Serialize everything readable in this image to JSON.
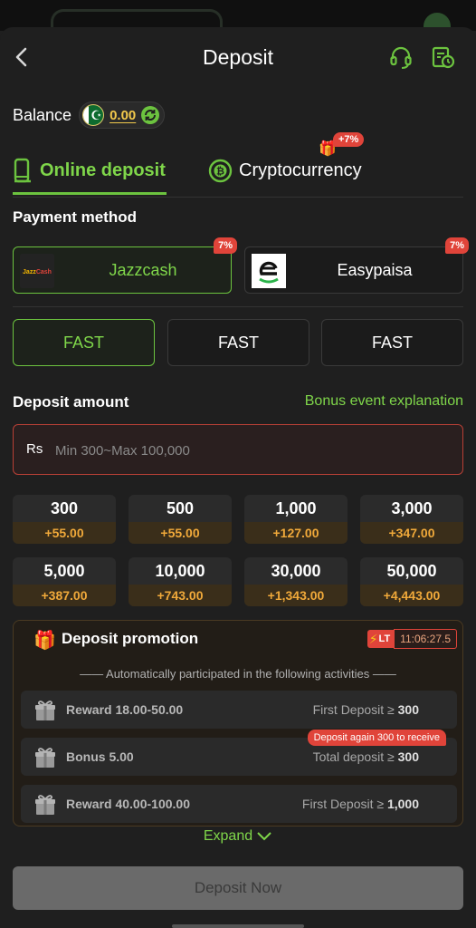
{
  "header": {
    "title": "Deposit"
  },
  "balance": {
    "label": "Balance",
    "currency_symbol": "☪",
    "value": "0.00"
  },
  "tabs": [
    {
      "label": "Online deposit",
      "active": true
    },
    {
      "label": "Cryptocurrency",
      "active": false,
      "badge": "+7%"
    }
  ],
  "payment": {
    "title": "Payment method",
    "methods": [
      {
        "name": "Jazzcash",
        "logo_text": "JazzCash",
        "badge": "7%",
        "active": true
      },
      {
        "name": "Easypaisa",
        "logo_text": "e",
        "badge": "7%",
        "active": false
      }
    ]
  },
  "channels": [
    {
      "label": "FAST",
      "active": true
    },
    {
      "label": "FAST",
      "active": false
    },
    {
      "label": "FAST",
      "active": false
    }
  ],
  "amount": {
    "title": "Deposit amount",
    "bonus_link": "Bonus event explanation",
    "currency": "Rs",
    "placeholder": "Min 300~Max 100,000",
    "value": ""
  },
  "chips": [
    {
      "amount": "300",
      "bonus": "+55.00"
    },
    {
      "amount": "500",
      "bonus": "+55.00"
    },
    {
      "amount": "1,000",
      "bonus": "+127.00"
    },
    {
      "amount": "3,000",
      "bonus": "+347.00"
    },
    {
      "amount": "5,000",
      "bonus": "+387.00"
    },
    {
      "amount": "10,000",
      "bonus": "+743.00"
    },
    {
      "amount": "30,000",
      "bonus": "+1,343.00"
    },
    {
      "amount": "50,000",
      "bonus": "+4,443.00"
    }
  ],
  "promotion": {
    "title": "Deposit promotion",
    "tag": "LT",
    "timer": "11:06:27.5",
    "note": "—— Automatically participated in the following activities ——",
    "activities": [
      {
        "name": "Reward 18.00-50.00",
        "condition": "First Deposit ≥",
        "threshold": "300",
        "badge": ""
      },
      {
        "name": "Bonus 5.00",
        "condition": "Total deposit ≥",
        "threshold": "300",
        "badge": "Deposit again 300 to receive"
      },
      {
        "name": "Reward 40.00-100.00",
        "condition": "First Deposit ≥",
        "threshold": "1,000",
        "badge": ""
      }
    ],
    "expand_label": "Expand"
  },
  "footer": {
    "deposit_button": "Deposit Now"
  },
  "colors": {
    "accent": "#6cc33f",
    "bonus": "#f0a93a",
    "badge": "#e0443a",
    "background": "#1f1f1f"
  }
}
